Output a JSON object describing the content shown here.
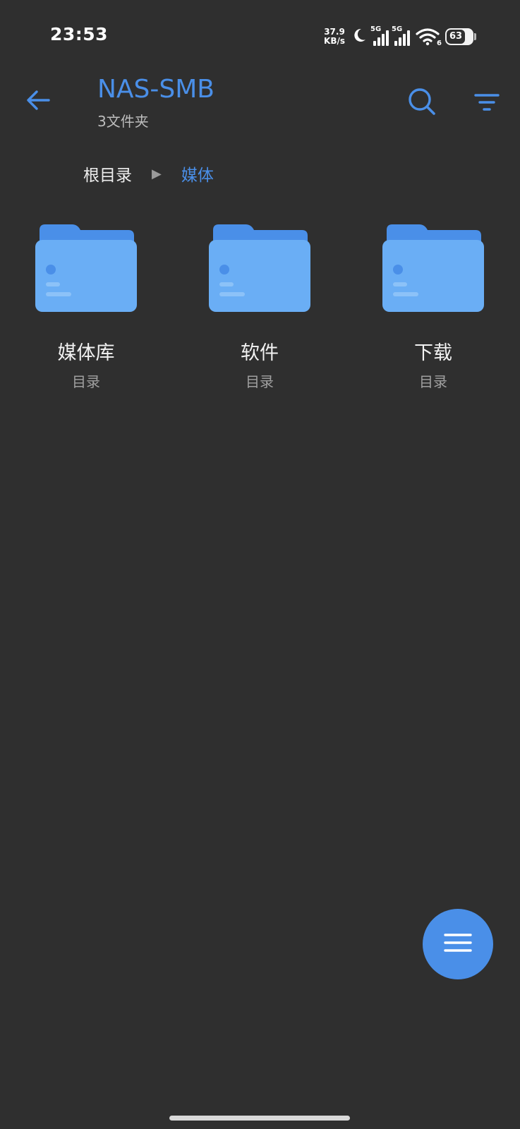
{
  "status": {
    "time": "23:53",
    "net_speed_value": "37.9",
    "net_speed_unit": "KB/s",
    "sim1": "5G",
    "sim2": "5G",
    "wifi_badge": "6",
    "battery": "63",
    "icons": [
      "moon-icon",
      "signal-icon",
      "wifi-icon",
      "battery-icon"
    ]
  },
  "header": {
    "title": "NAS-SMB",
    "subtitle": "3文件夹",
    "accent_color": "#4a8fe8"
  },
  "breadcrumb": {
    "root": "根目录",
    "current": "媒体"
  },
  "folders": [
    {
      "name": "媒体库",
      "kind": "目录"
    },
    {
      "name": "软件",
      "kind": "目录"
    },
    {
      "name": "下载",
      "kind": "目录"
    }
  ],
  "colors": {
    "background": "#2f2f2f",
    "folder_front": "#6aaef5",
    "folder_back": "#4a8fe8"
  }
}
